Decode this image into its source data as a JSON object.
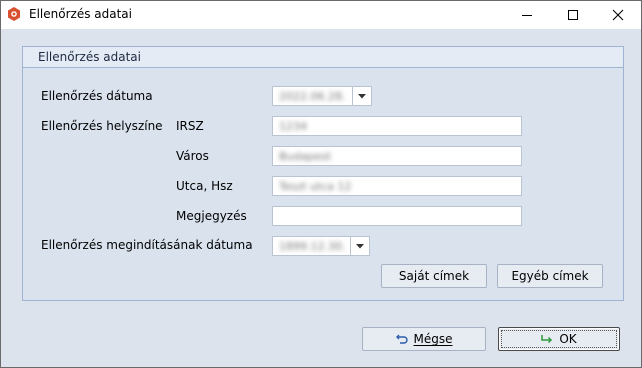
{
  "window": {
    "title": "Ellenőrzés adatai",
    "controls": {
      "minimize": "–",
      "maximize": "☐",
      "close": "✕"
    }
  },
  "group": {
    "title": "Ellenőrzés adatai",
    "rows": {
      "date_label": "Ellenőrzés dátuma",
      "date_value": "2022.06.28.",
      "location_label": "Ellenőrzés helyszíne",
      "irsz_label": "IRSZ",
      "irsz_value": "1234",
      "city_label": "Város",
      "city_value": "Budapest",
      "street_label": "Utca, Hsz",
      "street_value": "Teszt utca 12",
      "note_label": "Megjegyzés",
      "note_value": "",
      "start_date_label": "Ellenőrzés megindításának dátuma",
      "start_date_value": "1899.12.30."
    },
    "buttons": {
      "own_addresses": "Saját címek",
      "other_addresses": "Egyéb címek"
    }
  },
  "footer": {
    "cancel_label": "Mégse",
    "ok_label": "OK"
  },
  "colors": {
    "background": "#dce3ed",
    "group_border": "#9fb3d2",
    "cancel_icon": "#2a5caa",
    "ok_icon": "#2e9a3c",
    "app_icon": "#d9502e"
  }
}
